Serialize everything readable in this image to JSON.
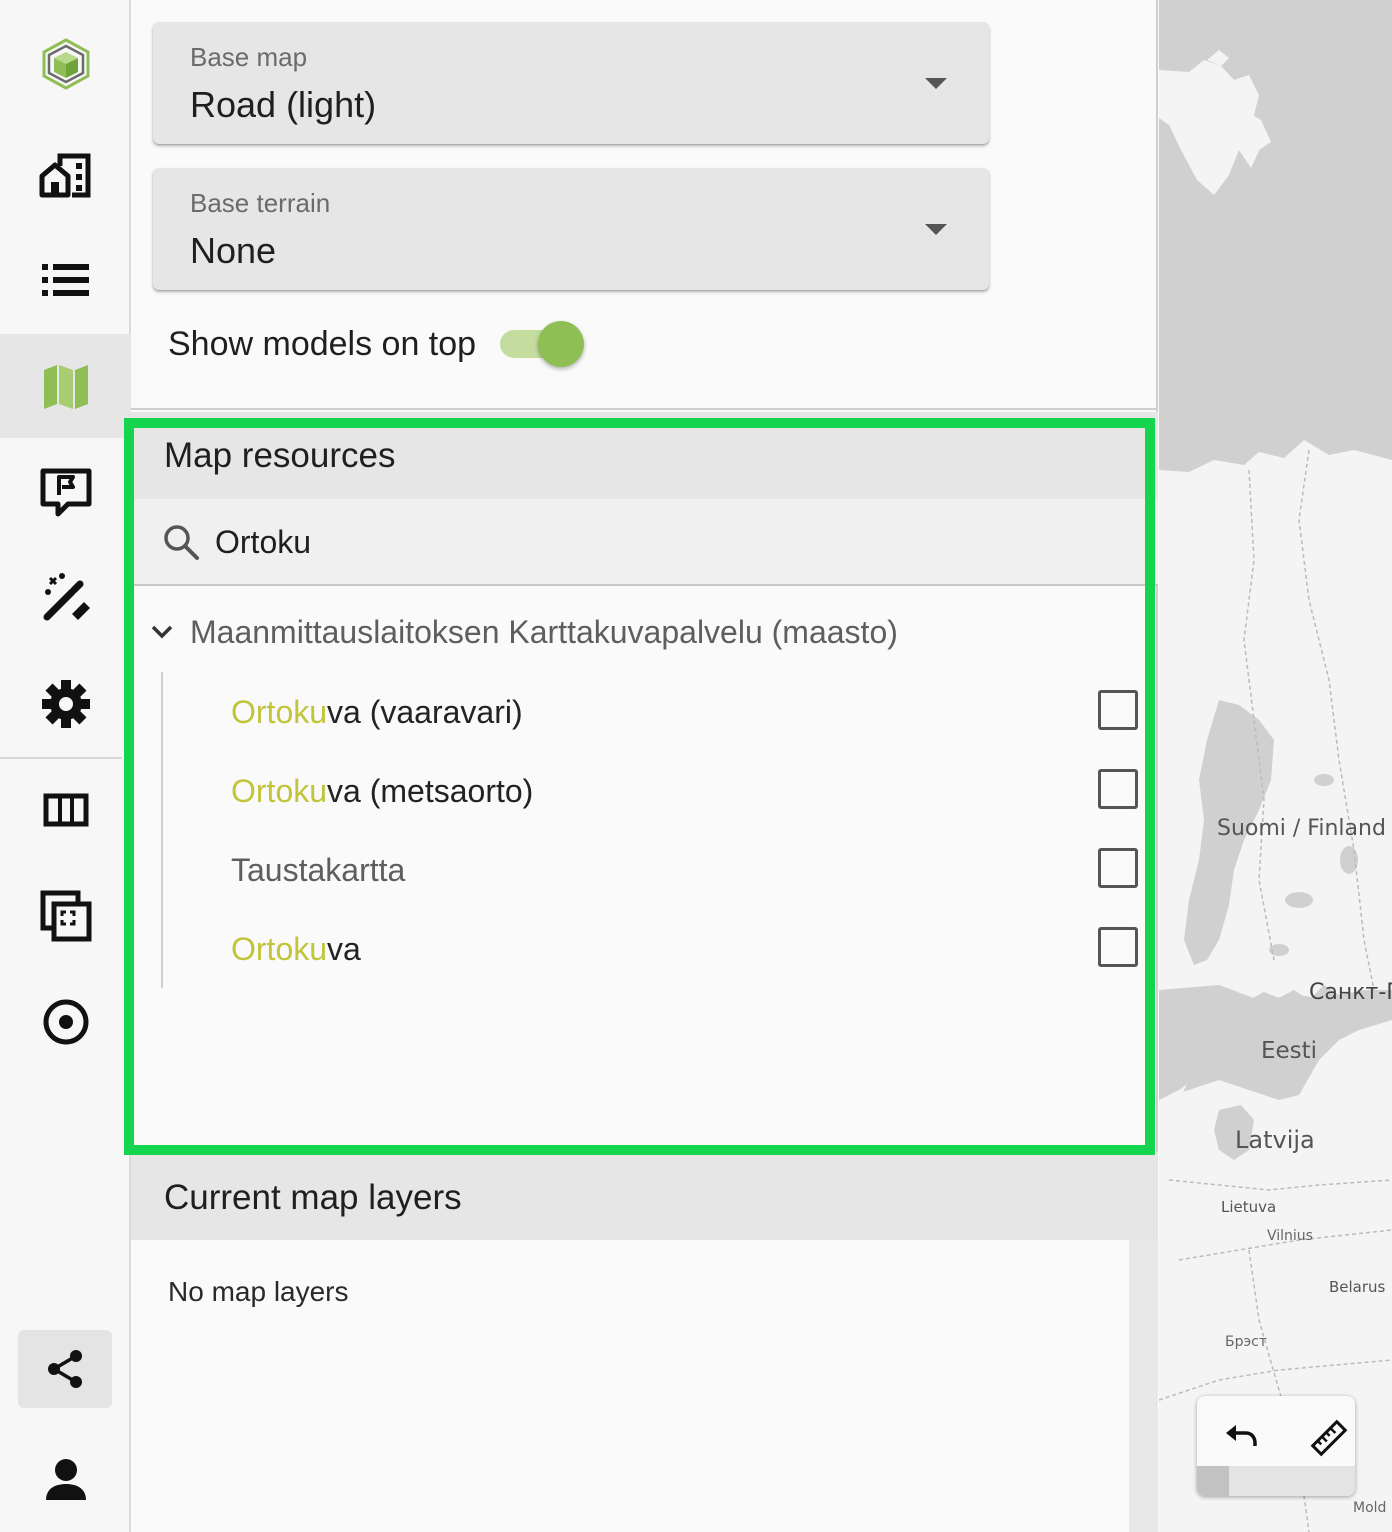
{
  "rail": {
    "items": [
      {
        "name": "logo-icon",
        "active": false
      },
      {
        "name": "buildings-icon",
        "active": false
      },
      {
        "name": "list-icon",
        "active": false
      },
      {
        "name": "map-icon",
        "active": true
      },
      {
        "name": "feedback-icon",
        "active": false
      },
      {
        "name": "tools-icon",
        "active": false
      },
      {
        "name": "settings-icon",
        "active": false
      },
      {
        "name": "columns-icon",
        "active": false
      },
      {
        "name": "selection-icon",
        "active": false
      },
      {
        "name": "target-icon",
        "active": false
      }
    ],
    "share_icon": "share-icon",
    "account_icon": "person-icon"
  },
  "base_map": {
    "label": "Base map",
    "value": "Road (light)"
  },
  "base_terrain": {
    "label": "Base terrain",
    "value": "None"
  },
  "models_toggle": {
    "label": "Show models on top",
    "on": true
  },
  "map_resources": {
    "title": "Map resources",
    "search": {
      "value": "Ortoku",
      "placeholder": ""
    },
    "group": {
      "label": "Maanmittauslaitoksen Karttakuvapalvelu (maasto)",
      "expanded": true,
      "items": [
        {
          "match": "Ortoku",
          "rest": "va (vaaravari)",
          "checked": false
        },
        {
          "match": "Ortoku",
          "rest": "va (metsaorto)",
          "checked": false
        },
        {
          "match": "",
          "rest": "Taustakartta",
          "checked": false
        },
        {
          "match": "Ortoku",
          "rest": "va",
          "checked": false
        }
      ]
    }
  },
  "current_layers": {
    "title": "Current map layers",
    "empty_text": "No map layers"
  },
  "map": {
    "labels": {
      "finland": "Suomi / Finland",
      "spb": "Санкт-П",
      "estonia": "Eesti",
      "latvia": "Latvija",
      "lithuania": "Lietuva",
      "vilnius": "Vilnius",
      "belarus": "Belarus",
      "brest": "Брэст",
      "moldova": "Mold"
    },
    "tools": [
      "undo-icon",
      "ruler-icon"
    ]
  },
  "colors": {
    "accent_green": "#8fbf54",
    "highlight_frame": "#15d44e",
    "match_highlight": "#c2c43a"
  }
}
